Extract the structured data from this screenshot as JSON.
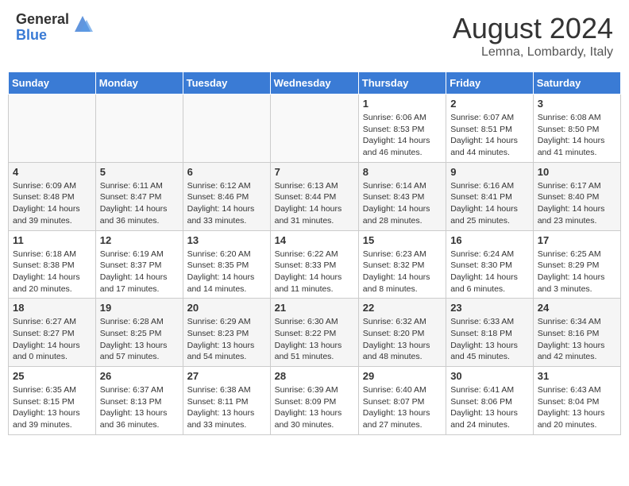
{
  "header": {
    "logo_general": "General",
    "logo_blue": "Blue",
    "month_year": "August 2024",
    "location": "Lemna, Lombardy, Italy"
  },
  "weekdays": [
    "Sunday",
    "Monday",
    "Tuesday",
    "Wednesday",
    "Thursday",
    "Friday",
    "Saturday"
  ],
  "weeks": [
    [
      {
        "day": "",
        "info": ""
      },
      {
        "day": "",
        "info": ""
      },
      {
        "day": "",
        "info": ""
      },
      {
        "day": "",
        "info": ""
      },
      {
        "day": "1",
        "info": "Sunrise: 6:06 AM\nSunset: 8:53 PM\nDaylight: 14 hours\nand 46 minutes."
      },
      {
        "day": "2",
        "info": "Sunrise: 6:07 AM\nSunset: 8:51 PM\nDaylight: 14 hours\nand 44 minutes."
      },
      {
        "day": "3",
        "info": "Sunrise: 6:08 AM\nSunset: 8:50 PM\nDaylight: 14 hours\nand 41 minutes."
      }
    ],
    [
      {
        "day": "4",
        "info": "Sunrise: 6:09 AM\nSunset: 8:48 PM\nDaylight: 14 hours\nand 39 minutes."
      },
      {
        "day": "5",
        "info": "Sunrise: 6:11 AM\nSunset: 8:47 PM\nDaylight: 14 hours\nand 36 minutes."
      },
      {
        "day": "6",
        "info": "Sunrise: 6:12 AM\nSunset: 8:46 PM\nDaylight: 14 hours\nand 33 minutes."
      },
      {
        "day": "7",
        "info": "Sunrise: 6:13 AM\nSunset: 8:44 PM\nDaylight: 14 hours\nand 31 minutes."
      },
      {
        "day": "8",
        "info": "Sunrise: 6:14 AM\nSunset: 8:43 PM\nDaylight: 14 hours\nand 28 minutes."
      },
      {
        "day": "9",
        "info": "Sunrise: 6:16 AM\nSunset: 8:41 PM\nDaylight: 14 hours\nand 25 minutes."
      },
      {
        "day": "10",
        "info": "Sunrise: 6:17 AM\nSunset: 8:40 PM\nDaylight: 14 hours\nand 23 minutes."
      }
    ],
    [
      {
        "day": "11",
        "info": "Sunrise: 6:18 AM\nSunset: 8:38 PM\nDaylight: 14 hours\nand 20 minutes."
      },
      {
        "day": "12",
        "info": "Sunrise: 6:19 AM\nSunset: 8:37 PM\nDaylight: 14 hours\nand 17 minutes."
      },
      {
        "day": "13",
        "info": "Sunrise: 6:20 AM\nSunset: 8:35 PM\nDaylight: 14 hours\nand 14 minutes."
      },
      {
        "day": "14",
        "info": "Sunrise: 6:22 AM\nSunset: 8:33 PM\nDaylight: 14 hours\nand 11 minutes."
      },
      {
        "day": "15",
        "info": "Sunrise: 6:23 AM\nSunset: 8:32 PM\nDaylight: 14 hours\nand 8 minutes."
      },
      {
        "day": "16",
        "info": "Sunrise: 6:24 AM\nSunset: 8:30 PM\nDaylight: 14 hours\nand 6 minutes."
      },
      {
        "day": "17",
        "info": "Sunrise: 6:25 AM\nSunset: 8:29 PM\nDaylight: 14 hours\nand 3 minutes."
      }
    ],
    [
      {
        "day": "18",
        "info": "Sunrise: 6:27 AM\nSunset: 8:27 PM\nDaylight: 14 hours\nand 0 minutes."
      },
      {
        "day": "19",
        "info": "Sunrise: 6:28 AM\nSunset: 8:25 PM\nDaylight: 13 hours\nand 57 minutes."
      },
      {
        "day": "20",
        "info": "Sunrise: 6:29 AM\nSunset: 8:23 PM\nDaylight: 13 hours\nand 54 minutes."
      },
      {
        "day": "21",
        "info": "Sunrise: 6:30 AM\nSunset: 8:22 PM\nDaylight: 13 hours\nand 51 minutes."
      },
      {
        "day": "22",
        "info": "Sunrise: 6:32 AM\nSunset: 8:20 PM\nDaylight: 13 hours\nand 48 minutes."
      },
      {
        "day": "23",
        "info": "Sunrise: 6:33 AM\nSunset: 8:18 PM\nDaylight: 13 hours\nand 45 minutes."
      },
      {
        "day": "24",
        "info": "Sunrise: 6:34 AM\nSunset: 8:16 PM\nDaylight: 13 hours\nand 42 minutes."
      }
    ],
    [
      {
        "day": "25",
        "info": "Sunrise: 6:35 AM\nSunset: 8:15 PM\nDaylight: 13 hours\nand 39 minutes."
      },
      {
        "day": "26",
        "info": "Sunrise: 6:37 AM\nSunset: 8:13 PM\nDaylight: 13 hours\nand 36 minutes."
      },
      {
        "day": "27",
        "info": "Sunrise: 6:38 AM\nSunset: 8:11 PM\nDaylight: 13 hours\nand 33 minutes."
      },
      {
        "day": "28",
        "info": "Sunrise: 6:39 AM\nSunset: 8:09 PM\nDaylight: 13 hours\nand 30 minutes."
      },
      {
        "day": "29",
        "info": "Sunrise: 6:40 AM\nSunset: 8:07 PM\nDaylight: 13 hours\nand 27 minutes."
      },
      {
        "day": "30",
        "info": "Sunrise: 6:41 AM\nSunset: 8:06 PM\nDaylight: 13 hours\nand 24 minutes."
      },
      {
        "day": "31",
        "info": "Sunrise: 6:43 AM\nSunset: 8:04 PM\nDaylight: 13 hours\nand 20 minutes."
      }
    ]
  ]
}
